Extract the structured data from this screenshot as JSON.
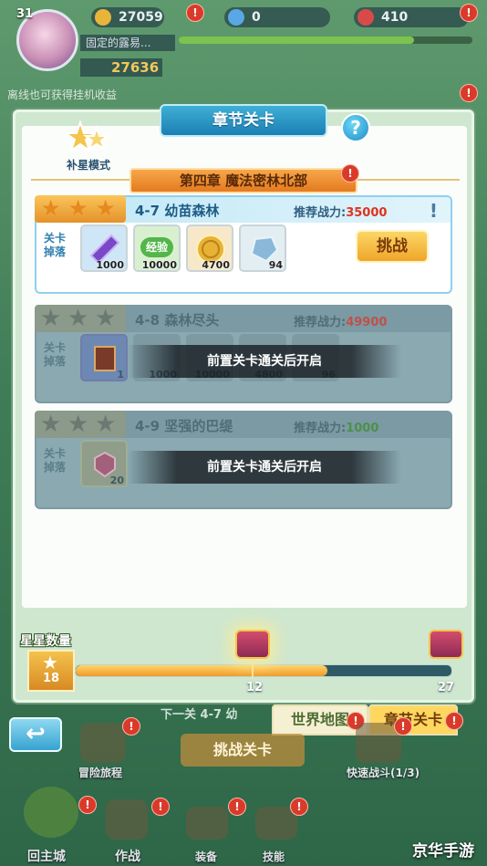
{
  "hud": {
    "level": "31",
    "gold": "27059",
    "gems": "0",
    "rubies": "410",
    "player_name": "固定的露易...",
    "combat_power": "27636",
    "offline_tip": "离线也可获得挂机收益"
  },
  "panel": {
    "title": "章节关卡",
    "help": "?",
    "mode_label": "补星模式",
    "chapter_title": "第四章  魔法密林北部"
  },
  "stages": [
    {
      "name": "4-7 幼苗森林",
      "recommend_label": "推荐战力:",
      "recommend_value": "35000",
      "stars": 3,
      "drop_label": "关卡掉落",
      "items": [
        {
          "icon": "purple-crystal-icon",
          "count": "1000"
        },
        {
          "icon": "experience-orb-icon",
          "text": "经验",
          "count": "10000"
        },
        {
          "icon": "gold-coin-icon",
          "count": "4700"
        },
        {
          "icon": "blue-crystal-icon",
          "count": "94"
        }
      ],
      "button": "挑战",
      "locked": false
    },
    {
      "name": "4-8 森林尽头",
      "recommend_label": "推荐战力:",
      "recommend_value": "49900",
      "stars": 0,
      "drop_label": "关卡掉落",
      "items": [
        {
          "icon": "book-icon",
          "count": "1"
        },
        {
          "icon": "purple-crystal-icon",
          "count": "1000"
        },
        {
          "icon": "experience-orb-icon",
          "count": "10000"
        },
        {
          "icon": "gold-coin-icon",
          "count": "4800"
        },
        {
          "icon": "blue-crystal-icon",
          "count": "96"
        }
      ],
      "lock_message": "前置关卡通关后开启",
      "locked": true
    },
    {
      "name": "4-9 坚强的巴缇",
      "recommend_label": "推荐战力:",
      "recommend_value": "1000",
      "stars": 0,
      "drop_label": "关卡掉落",
      "items": [
        {
          "icon": "red-gem-icon",
          "count": "20"
        }
      ],
      "lock_message": "前置关卡通关后开启",
      "locked": true
    }
  ],
  "star_progress": {
    "label": "星星数量",
    "current": "18",
    "milestones": [
      "12",
      "27"
    ],
    "progress_fraction": 0.67
  },
  "tabs": {
    "world_map": "世界地图",
    "chapter_levels": "章节关卡"
  },
  "background": {
    "next_level": "下一关 4-7 幼",
    "challenge_level": "挑战关卡",
    "adventure": "冒险旅程",
    "quick_battle": "快速战斗(1/3)",
    "home": "回主城",
    "formation": "作战",
    "equipment": "装备",
    "skills": "技能",
    "watermark": "京华手游"
  },
  "colors": {
    "accent_blue": "#1c7fb3",
    "accent_orange": "#e47a1f",
    "recommend_red": "#e0321e",
    "alert_red": "#d93a2a"
  }
}
